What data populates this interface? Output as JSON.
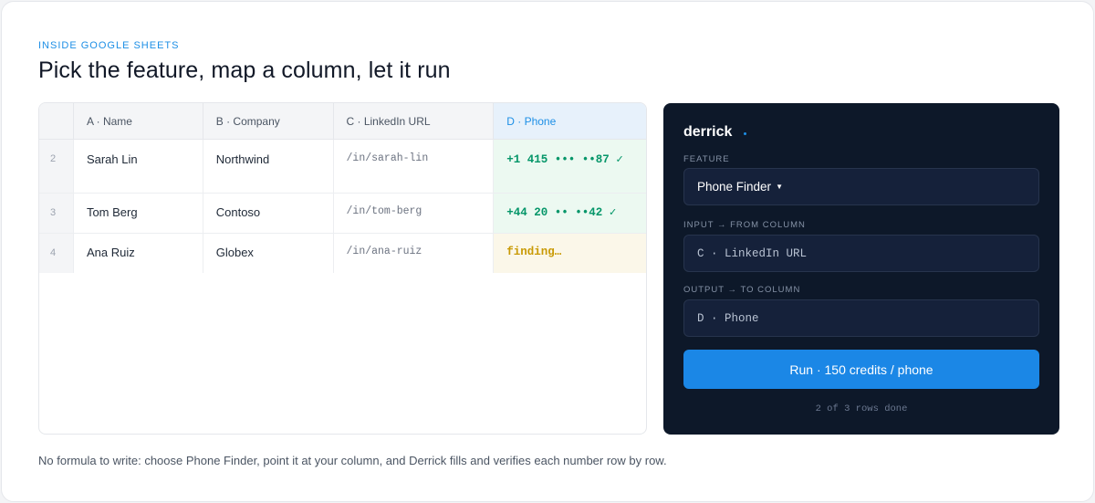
{
  "header": {
    "eyebrow": "INSIDE GOOGLE SHEETS",
    "title": "Pick the feature, map a column, let it run"
  },
  "sheet": {
    "columns": [
      "A · Name",
      "B · Company",
      "C · LinkedIn URL",
      "D · Phone"
    ],
    "active_column_color": "#1d8fe6",
    "rows": [
      {
        "num": "2",
        "name": "Sarah Lin",
        "company": "Northwind",
        "linkedin": "/in/sarah-lin",
        "phone": "+1 415 ••• ••87 ✓",
        "status": "done"
      },
      {
        "num": "3",
        "name": "Tom Berg",
        "company": "Contoso",
        "linkedin": "/in/tom-berg",
        "phone": "+44 20 •• ••42 ✓",
        "status": "done"
      },
      {
        "num": "4",
        "name": "Ana Ruiz",
        "company": "Globex",
        "linkedin": "/in/ana-ruiz",
        "phone": "finding…",
        "status": "pending"
      }
    ]
  },
  "panel": {
    "brand": "derrick",
    "feature_label": "FEATURE",
    "feature_value": "Phone Finder",
    "input_label": "INPUT → FROM COLUMN",
    "input_value": "C · LinkedIn URL",
    "output_label": "OUTPUT → TO COLUMN",
    "output_value": "D · Phone",
    "run_label": "Run · 150 credits / phone",
    "progress": "2 of 3 rows done",
    "colors": {
      "background": "#0d1829",
      "accent": "#1b87e6",
      "success": "#059669",
      "pending": "#c99a05"
    }
  },
  "caption": "No formula to write: choose Phone Finder, point it at your column, and Derrick fills and verifies each number row by row."
}
